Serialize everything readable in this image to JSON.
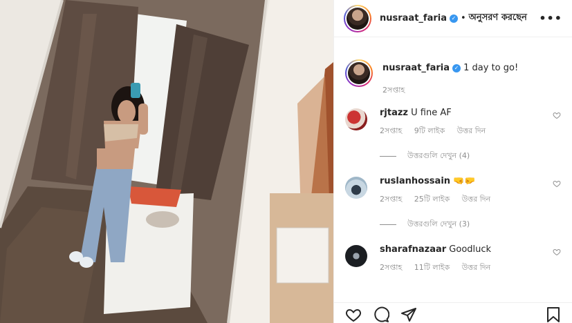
{
  "header": {
    "username": "nusraat_faria",
    "separator": "•",
    "follow_label": "অনুসরণ করছেন",
    "more_label": "•••"
  },
  "caption": {
    "username": "nusraat_faria",
    "text": "1 day to go!",
    "time": "2সপ্তাহ"
  },
  "comments": [
    {
      "username": "rjtazz",
      "text": "U fine AF",
      "time": "2সপ্তাহ",
      "likes": "9টি লাইক",
      "reply": "উত্তর দিন",
      "view_replies": "উত্তরগুলি দেখুন (4)"
    },
    {
      "username": "ruslanhossain",
      "text": "🤜🤛",
      "time": "2সপ্তাহ",
      "likes": "25টি লাইক",
      "reply": "উত্তর দিন",
      "view_replies": "উত্তরগুলি দেখুন (3)"
    },
    {
      "username": "sharafnazaar",
      "text": "Goodluck",
      "time": "2সপ্তাহ",
      "likes": "11টি লাইক",
      "reply": "উত্তর দিন"
    }
  ],
  "icons": {
    "verified": "verified-badge-icon",
    "like": "heart-icon",
    "comment": "comment-bubble-icon",
    "share": "paper-plane-icon",
    "save": "bookmark-icon"
  },
  "colors": {
    "verified": "#3897f0",
    "muted": "#8e8e8e",
    "text": "#262626"
  }
}
